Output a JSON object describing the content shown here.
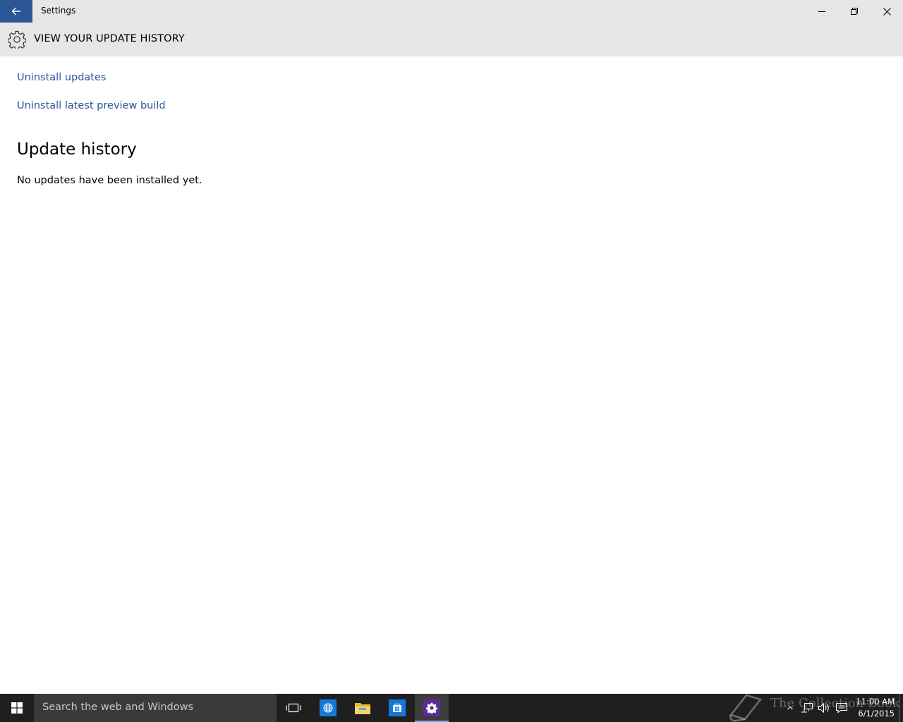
{
  "window": {
    "title": "Settings",
    "back_icon": "arrow-left-icon",
    "controls": [
      "minimize-icon",
      "restore-icon",
      "close-icon"
    ]
  },
  "header": {
    "icon": "gear-icon",
    "title": "VIEW YOUR UPDATE HISTORY"
  },
  "links": {
    "uninstall_updates": "Uninstall updates",
    "uninstall_preview": "Uninstall latest preview build"
  },
  "history": {
    "title": "Update history",
    "empty_message": "No updates have been installed yet."
  },
  "taskbar": {
    "search_placeholder": "Search the web and Windows",
    "apps": [
      "task-view-icon",
      "browser-icon",
      "file-explorer-icon",
      "store-icon",
      "settings-icon"
    ],
    "watermark": "The Collection Book",
    "tray": [
      "chevron-up-icon",
      "network-icon",
      "volume-icon",
      "action-center-icon"
    ],
    "clock": {
      "time": "11:00 AM",
      "date": "6/1/2015"
    }
  },
  "colors": {
    "accent": "#2b5797",
    "titlebar_bg": "#e6e6e6",
    "taskbar_bg": "#1f1f1f",
    "link": "#2b5797"
  }
}
